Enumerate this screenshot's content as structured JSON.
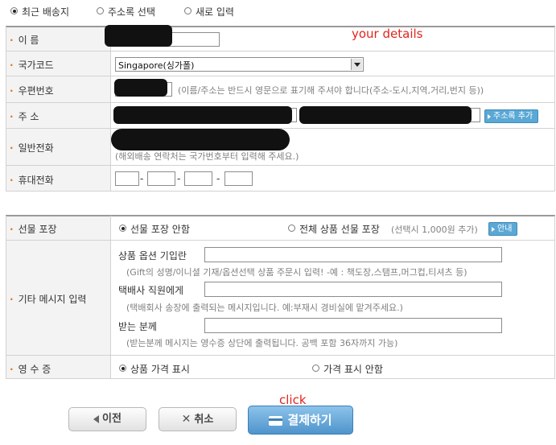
{
  "address_options": {
    "recent": "최근 배송지",
    "address_book": "주소록 선택",
    "new": "새로 입력",
    "selected": "recent"
  },
  "annotations": {
    "details": "your details",
    "click": "click"
  },
  "form": {
    "name_label": "이 름",
    "country_label": "국가코드",
    "country_value": "Singapore(싱가폴)",
    "postal_label": "우편번호",
    "postal_note": "(이름/주소는 반드시 영문으로 표기해 주셔야 합니다(주소-도시,지역,거리,번지 등))",
    "address_label": "주 소",
    "address_book_button": "주소록 추가",
    "phone_label": "일반전화",
    "phone_note": "(해외배송 연락처는 국가번호부터 입력해 주세요.)",
    "mobile_label": "휴대전화",
    "dash": "-"
  },
  "extra": {
    "gift_label": "선물 포장",
    "gift_no": "선물 포장 안함",
    "gift_all": "전체 상품 선물 포장",
    "gift_fee": "(선택시 1,000원 추가)",
    "guide_button": "안내",
    "message_label": "기타 메시지 입력",
    "option_label": "상품 옵션 기입란",
    "option_note": "(Gift의 성명/이니셜 기재/옵션선택 상품 주문시 입력! -예 : 책도장,스탬프,머그컵,티셔츠 등)",
    "courier_label": "택배사 직원에게",
    "courier_note": "(택배회사 송장에 출력되는 메시지입니다. 예:부재시 경비실에 맡겨주세요.)",
    "recipient_label": "받는 분께",
    "recipient_note": "(받는분께 메시지는 영수증 상단에 출력됩니다. 공백 포함 36자까지 가능)",
    "receipt_label": "영 수 증",
    "receipt_show": "상품 가격 표시",
    "receipt_hide": "가격 표시 안함"
  },
  "buttons": {
    "prev": "이전",
    "cancel": "취소",
    "pay": "결제하기"
  },
  "colors": {
    "bullet": "#e3761b",
    "annotation": "#e0251b",
    "accent": "#5aa8d6"
  }
}
